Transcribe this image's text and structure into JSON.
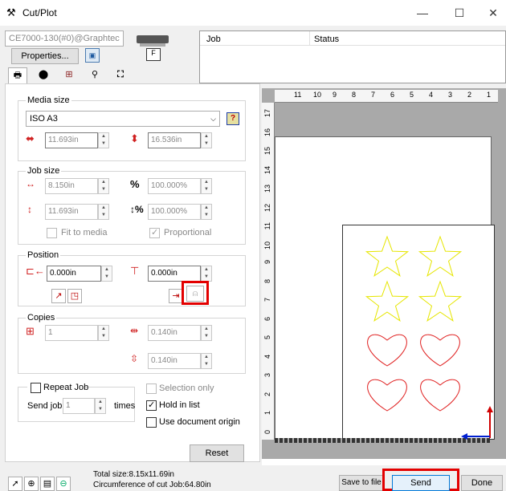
{
  "window": {
    "title": "Cut/Plot",
    "minimize": "—",
    "maximize": "☐",
    "close": "✕"
  },
  "device": {
    "selected": "CE7000-130(#0)@Graphtec",
    "properties_label": "Properties..."
  },
  "job_table": {
    "col_job": "Job",
    "col_status": "Status"
  },
  "media_size": {
    "legend": "Media size",
    "selected": "ISO A3",
    "width": "11.693in",
    "height": "16.536in"
  },
  "job_size": {
    "legend": "Job size",
    "width": "8.150in",
    "height": "11.693in",
    "scale_x": "100.000%",
    "scale_y": "100.000%",
    "fit_to_media": "Fit to media",
    "proportional": "Proportional"
  },
  "position": {
    "legend": "Position",
    "x": "0.000in",
    "y": "0.000in"
  },
  "copies": {
    "legend": "Copies",
    "count": "1",
    "gap_x": "0.140in",
    "gap_y": "0.140in"
  },
  "repeat": {
    "repeat_job": "Repeat Job",
    "send_job": "Send job",
    "send_count": "1",
    "times": "times",
    "selection_only": "Selection only",
    "hold_in_list": "Hold in list",
    "use_document_origin": "Use document origin"
  },
  "reset_label": "Reset",
  "ruler_top": [
    "11",
    "10",
    "9",
    "8",
    "7",
    "6",
    "5",
    "4",
    "3",
    "2",
    "1"
  ],
  "ruler_left": [
    "17",
    "16",
    "15",
    "14",
    "13",
    "12",
    "11",
    "10",
    "9",
    "8",
    "7",
    "6",
    "5",
    "4",
    "3",
    "2",
    "1",
    "0"
  ],
  "status": {
    "total_size": "Total size:8.15x11.69in",
    "circumference": "Circumference of cut Job:64.80in"
  },
  "footer": {
    "save_to_file": "Save to file",
    "send": "Send",
    "done": "Done"
  },
  "colors": {
    "stars": "#e6e600",
    "hearts": "#e02020",
    "highlight": "#e30000"
  },
  "shapes": {
    "rows": [
      [
        "star",
        "star"
      ],
      [
        "star",
        "star"
      ],
      [
        "heart",
        "heart"
      ],
      [
        "heart",
        "heart"
      ]
    ]
  }
}
